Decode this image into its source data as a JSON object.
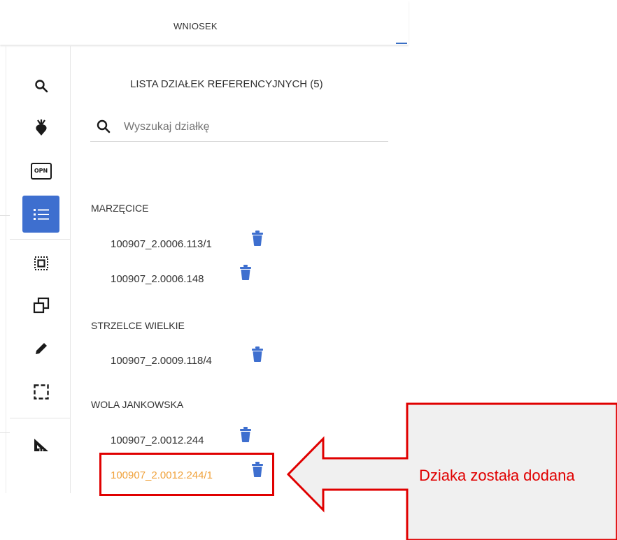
{
  "header": {
    "tab_label": "WNIOSEK"
  },
  "toolbar": {
    "items": [
      {
        "name": "search-icon"
      },
      {
        "name": "beet-icon"
      },
      {
        "name": "opn-icon",
        "label": "OPN"
      },
      {
        "name": "list-icon",
        "active": true
      },
      {
        "name": "select-area-icon"
      },
      {
        "name": "copy-icon"
      },
      {
        "name": "pencil-icon"
      },
      {
        "name": "rectangle-select-icon"
      },
      {
        "name": "measure-icon"
      }
    ],
    "active_color": "#3e6fcf"
  },
  "panel": {
    "title": "LISTA DZIAŁEK REFERENCYJNYCH (5)",
    "search_placeholder": "Wyszukaj działkę",
    "groups": [
      {
        "name": "MARZĘCICE",
        "parcels": [
          "100907_2.0006.113/1",
          "100907_2.0006.148"
        ]
      },
      {
        "name": "STRZELCE WIELKIE",
        "parcels": [
          "100907_2.0009.118/4"
        ]
      },
      {
        "name": "WOLA JANKOWSKA",
        "parcels": [
          "100907_2.0012.244",
          "100907_2.0012.244/1"
        ]
      }
    ],
    "new_parcel_color": "#f0a13a",
    "trash_color": "#3e6fcf"
  },
  "annotation": {
    "callout_text": "Dziaka została dodana",
    "color": "#e00000"
  }
}
